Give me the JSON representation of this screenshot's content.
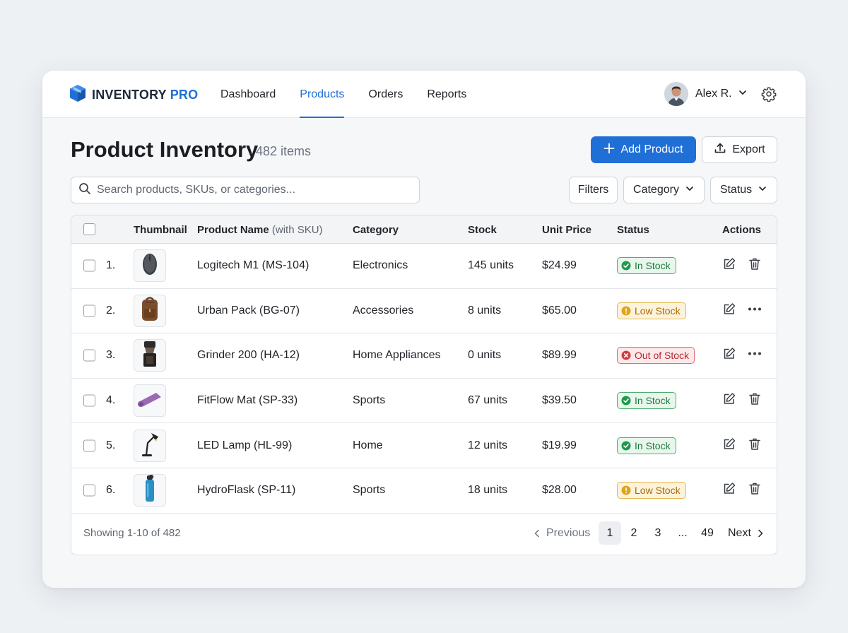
{
  "app": {
    "brand_main": "INVENTORY",
    "brand_accent": "PRO",
    "accent_color": "#1f6fd6"
  },
  "nav": {
    "links": [
      "Dashboard",
      "Products",
      "Orders",
      "Reports"
    ],
    "active": "Products"
  },
  "user": {
    "name": "Alex R.",
    "avatar_icon": "user-avatar"
  },
  "header": {
    "title": "Product Inventory",
    "count": "482 items",
    "add_button": "Add Product",
    "export_button": "Export"
  },
  "search": {
    "placeholder": "Search products, SKUs, or categories...",
    "value": ""
  },
  "filters": {
    "filters_label": "Filters",
    "category_label": "Category",
    "status_label": "Status"
  },
  "table": {
    "columns": {
      "thumbnail": "Thumbnail",
      "name": "Product Name",
      "name_sub": "(with SKU)",
      "category": "Category",
      "stock": "Stock",
      "price": "Unit Price",
      "status": "Status",
      "actions": "Actions"
    },
    "rows": [
      {
        "index": "1.",
        "name": "Logitech M1 (MS-104)",
        "category": "Electronics",
        "stock": "145 units",
        "price": "$24.99",
        "status": "In Stock",
        "status_kind": "green",
        "thumb_icon": "mouse-icon",
        "secondary_action": "delete"
      },
      {
        "index": "2.",
        "name": "Urban Pack (BG-07)",
        "category": "Accessories",
        "stock": "8 units",
        "price": "$65.00",
        "status": "Low Stock",
        "status_kind": "amber",
        "thumb_icon": "backpack-icon",
        "secondary_action": "more"
      },
      {
        "index": "3.",
        "name": "Grinder 200 (HA-12)",
        "category": "Home Appliances",
        "stock": "0 units",
        "price": "$89.99",
        "status": "Out of Stock",
        "status_kind": "red",
        "thumb_icon": "grinder-icon",
        "secondary_action": "more"
      },
      {
        "index": "4.",
        "name": "FitFlow Mat (SP-33)",
        "category": "Sports",
        "stock": "67 units",
        "price": "$39.50",
        "status": "In Stock",
        "status_kind": "green",
        "thumb_icon": "yoga-mat-icon",
        "secondary_action": "delete"
      },
      {
        "index": "5.",
        "name": "LED Lamp (HL-99)",
        "category": "Home",
        "stock": "12 units",
        "price": "$19.99",
        "status": "In Stock",
        "status_kind": "green",
        "thumb_icon": "desk-lamp-icon",
        "secondary_action": "delete"
      },
      {
        "index": "6.",
        "name": "HydroFlask (SP-11)",
        "category": "Sports",
        "stock": "18 units",
        "price": "$28.00",
        "status": "Low Stock",
        "status_kind": "amber",
        "thumb_icon": "water-bottle-icon",
        "secondary_action": "delete"
      }
    ]
  },
  "footer": {
    "showing": "Showing 1-10 of 482",
    "previous": "Previous",
    "pages": [
      "1",
      "2",
      "3",
      "...",
      "49"
    ],
    "current_page": "1",
    "next": "Next"
  },
  "status_colors": {
    "green": "#1d7a3e",
    "amber": "#a86a00",
    "red": "#b42a33"
  }
}
